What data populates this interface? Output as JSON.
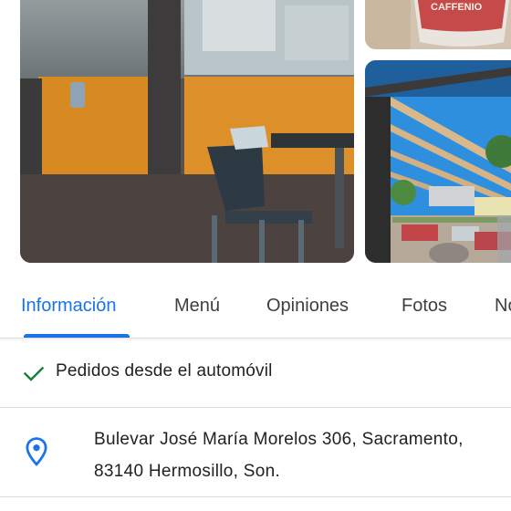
{
  "photos": {
    "cup_brand": "CAFFENIO"
  },
  "tabs": [
    {
      "label": "Información"
    },
    {
      "label": "Menú"
    },
    {
      "label": "Opiniones"
    },
    {
      "label": "Fotos"
    },
    {
      "label": "No"
    }
  ],
  "feature": {
    "icon": "check-icon",
    "text": "Pedidos desde el automóvil"
  },
  "address": {
    "icon": "location-pin-icon",
    "line1": "Bulevar José María Morelos 306, Sacramento,",
    "line2": "83140 Hermosillo, Son."
  },
  "colors": {
    "accent": "#1a73e8",
    "check": "#188038",
    "text": "#202124",
    "tab_text": "#3c4043",
    "divider": "#dadce0"
  }
}
